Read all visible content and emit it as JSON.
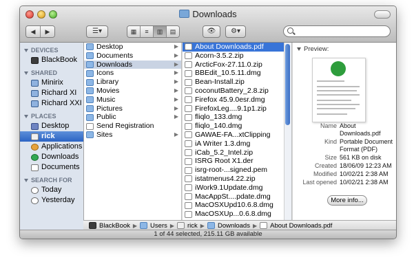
{
  "window": {
    "title": "Downloads"
  },
  "toolbar": {
    "back_forward": [
      "◀",
      "▶"
    ],
    "search_placeholder": ""
  },
  "sidebar": {
    "sections": [
      {
        "title": "DEVICES",
        "items": [
          {
            "label": "BlackBook",
            "icon": "hd-icon"
          }
        ]
      },
      {
        "title": "SHARED",
        "items": [
          {
            "label": "Minirix",
            "icon": "monitor-icon"
          },
          {
            "label": "Richard XI",
            "icon": "monitor-icon"
          },
          {
            "label": "Richard XXI",
            "icon": "monitor-icon"
          }
        ]
      },
      {
        "title": "PLACES",
        "items": [
          {
            "label": "Desktop",
            "icon": "desktop-icon"
          },
          {
            "label": "rick",
            "icon": "home-icon",
            "selected": true
          },
          {
            "label": "Applications",
            "icon": "applications-icon"
          },
          {
            "label": "Downloads",
            "icon": "downloads-icon"
          },
          {
            "label": "Documents",
            "icon": "documents-icon"
          }
        ]
      },
      {
        "title": "SEARCH FOR",
        "items": [
          {
            "label": "Today",
            "icon": "clock-icon"
          },
          {
            "label": "Yesterday",
            "icon": "clock-icon"
          }
        ]
      }
    ]
  },
  "column1": {
    "items": [
      {
        "label": "Desktop",
        "arrow": true
      },
      {
        "label": "Documents",
        "arrow": true
      },
      {
        "label": "Downloads",
        "arrow": true,
        "selected": true
      },
      {
        "label": "Icons",
        "arrow": true
      },
      {
        "label": "Library",
        "arrow": true
      },
      {
        "label": "Movies",
        "arrow": true
      },
      {
        "label": "Music",
        "arrow": true
      },
      {
        "label": "Pictures",
        "arrow": true
      },
      {
        "label": "Public",
        "arrow": true
      },
      {
        "label": "Send Registration",
        "arrow": false
      },
      {
        "label": "Sites",
        "arrow": true
      }
    ]
  },
  "column2": {
    "items": [
      {
        "label": "About Downloads.pdf",
        "selected": true
      },
      {
        "label": "Acorn-3.5.2.zip"
      },
      {
        "label": "ArcticFox-27.11.0.zip"
      },
      {
        "label": "BBEdit_10.5.11.dmg"
      },
      {
        "label": "Bean-Install.zip"
      },
      {
        "label": "coconutBattery_2.8.zip"
      },
      {
        "label": "Firefox 45.9.0esr.dmg"
      },
      {
        "label": "FirefoxLeg....9.1p1.zip"
      },
      {
        "label": "fliqlo_133.dmg"
      },
      {
        "label": "fliqlo_140.dmg"
      },
      {
        "label": "GAWAE-FA...xtClipping"
      },
      {
        "label": "iA Writer 1.3.dmg"
      },
      {
        "label": "iCab_5.2_Intel.zip"
      },
      {
        "label": "ISRG Root X1.der"
      },
      {
        "label": "isrg-root-...signed.pem"
      },
      {
        "label": "istatmenus4.22.zip"
      },
      {
        "label": "iWork9.1Update.dmg"
      },
      {
        "label": "MacAppSt....pdate.dmg"
      },
      {
        "label": "MacOSXUpd10.6.8.dmg"
      },
      {
        "label": "MacOSXUp...0.6.8.dmg"
      }
    ]
  },
  "preview": {
    "heading": "Preview:",
    "fields": [
      {
        "key": "Name",
        "value": "About Downloads.pdf"
      },
      {
        "key": "Kind",
        "value": "Portable Document Format (PDF)"
      },
      {
        "key": "Size",
        "value": "561 KB on disk"
      },
      {
        "key": "Created",
        "value": "18/06/09 12:23 AM"
      },
      {
        "key": "Modified",
        "value": "10/02/21 2:38 AM"
      },
      {
        "key": "Last opened",
        "value": "10/02/21 2:38 AM"
      }
    ],
    "more_info_label": "More info..."
  },
  "pathbar": [
    "BlackBook",
    "Users",
    "rick",
    "Downloads",
    "About Downloads.pdf"
  ],
  "status": "1 of 44 selected, 215.11 GB available"
}
